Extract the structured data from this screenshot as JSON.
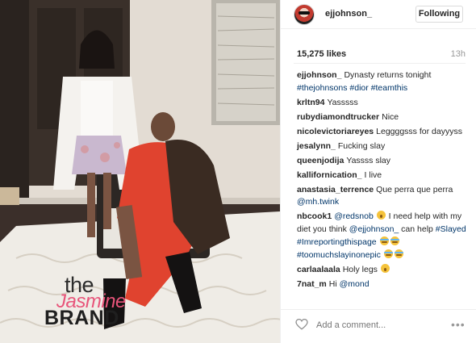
{
  "photo": {
    "alt": "",
    "watermark": {
      "line1": "the",
      "line2": "Jasmine",
      "line3": "BRAND"
    }
  },
  "header": {
    "username": "ejjohnson_",
    "follow_label": "Following"
  },
  "stats": {
    "likes": "15,275 likes",
    "age": "13h"
  },
  "comments": [
    {
      "user": "ejjohnson_",
      "text": "Dynasty returns tonight",
      "tags": "#thejohnsons #dior #teamthis"
    },
    {
      "user": "krltn94",
      "text": "Yasssss"
    },
    {
      "user": "rubydiamondtrucker",
      "text": "Nice"
    },
    {
      "user": "nicolevictoriareyes",
      "text": "Leggggsss for dayyyss"
    },
    {
      "user": "jesalynn_",
      "text": "Fucking slay"
    },
    {
      "user": "queenjodija",
      "text": "Yassss slay"
    },
    {
      "user": "kallifornication_",
      "text": "I live"
    },
    {
      "user": "anastasia_terrence",
      "text": "Que perra que perra",
      "mention": "@mh.twink"
    },
    {
      "user": "nbcook1",
      "mention1": "@redsnob",
      "text1": "I need help with my diet you think",
      "mention2": "@ejjohnson_",
      "text2": "can help",
      "tags": "#Slayed #Imreportingthispage",
      "tags2": "#toomuchslayinonepic"
    },
    {
      "user": "carlaalaala",
      "text": "Holy legs"
    },
    {
      "user": "7nat_m",
      "text": "Hi",
      "mention": "@mond"
    }
  ],
  "footer": {
    "add_comment_placeholder": "Add a comment...",
    "more_label": "•••"
  },
  "colors": {
    "dress": "#e0432f",
    "coat": "#f4f2ee",
    "link": "#003569"
  }
}
